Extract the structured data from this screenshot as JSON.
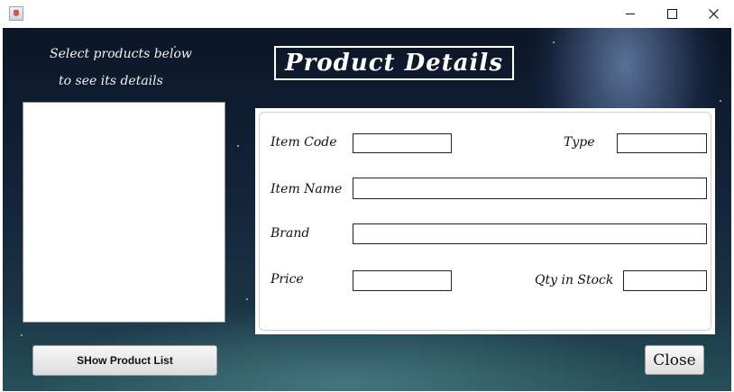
{
  "window": {
    "minimize_glyph": "—",
    "maximize_glyph": "☐",
    "close_glyph": "✕"
  },
  "sidebar": {
    "instruction_line1": "Select products below",
    "instruction_line2": "to see its details",
    "show_button_label": "SHow Product List"
  },
  "header": {
    "title": "Product Details"
  },
  "form": {
    "item_code_label": "Item Code",
    "item_code_value": "",
    "type_label": "Type",
    "type_value": "",
    "item_name_label": "Item Name",
    "item_name_value": "",
    "brand_label": "Brand",
    "brand_value": "",
    "price_label": "Price",
    "price_value": "",
    "qty_label": "Qty in Stock",
    "qty_value": ""
  },
  "footer": {
    "close_label": "Close"
  },
  "colors": {
    "background_dark": "#0c1727",
    "background_teal": "#27505a",
    "title_border": "#ffffff"
  }
}
